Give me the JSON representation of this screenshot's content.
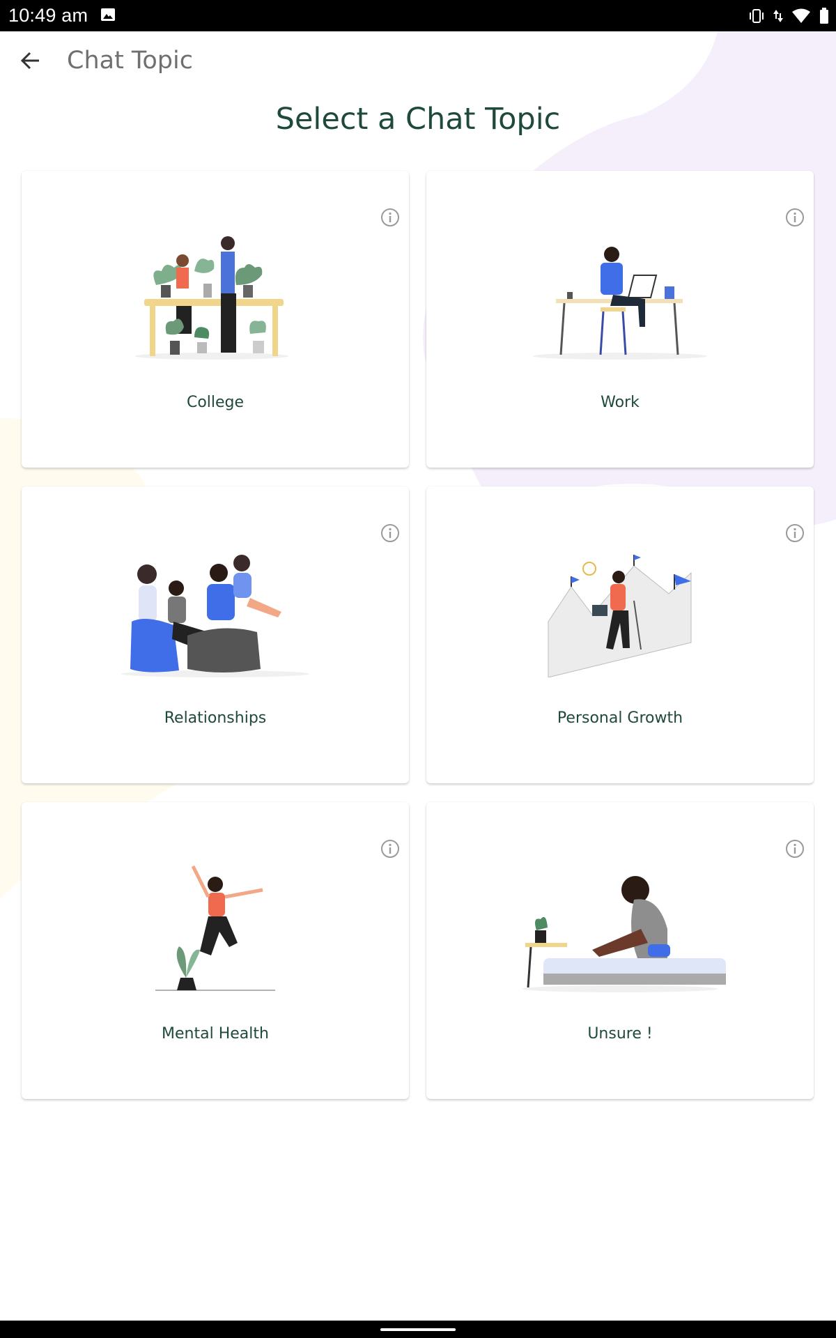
{
  "status_bar": {
    "time": "10:49 am",
    "icons": [
      "image-icon",
      "vibrate-icon",
      "data-arrows-icon",
      "wifi-icon",
      "battery-icon"
    ]
  },
  "app_bar": {
    "title": "Chat Topic",
    "back_icon": "arrow-left-icon"
  },
  "heading": "Select a Chat Topic",
  "topics": [
    {
      "label": "College",
      "illustration": "plants-people-illustration"
    },
    {
      "label": "Work",
      "illustration": "desk-worker-illustration"
    },
    {
      "label": "Relationships",
      "illustration": "family-illustration"
    },
    {
      "label": "Personal Growth",
      "illustration": "mountain-climber-illustration"
    },
    {
      "label": "Mental Health",
      "illustration": "jumping-woman-illustration"
    },
    {
      "label": "Unsure !",
      "illustration": "sitting-person-illustration"
    }
  ],
  "colors": {
    "heading": "#1f4a3a",
    "accent_blue": "#3f6ee8",
    "blob_purple": "#f5effb",
    "blob_yellow": "#fffcef"
  }
}
